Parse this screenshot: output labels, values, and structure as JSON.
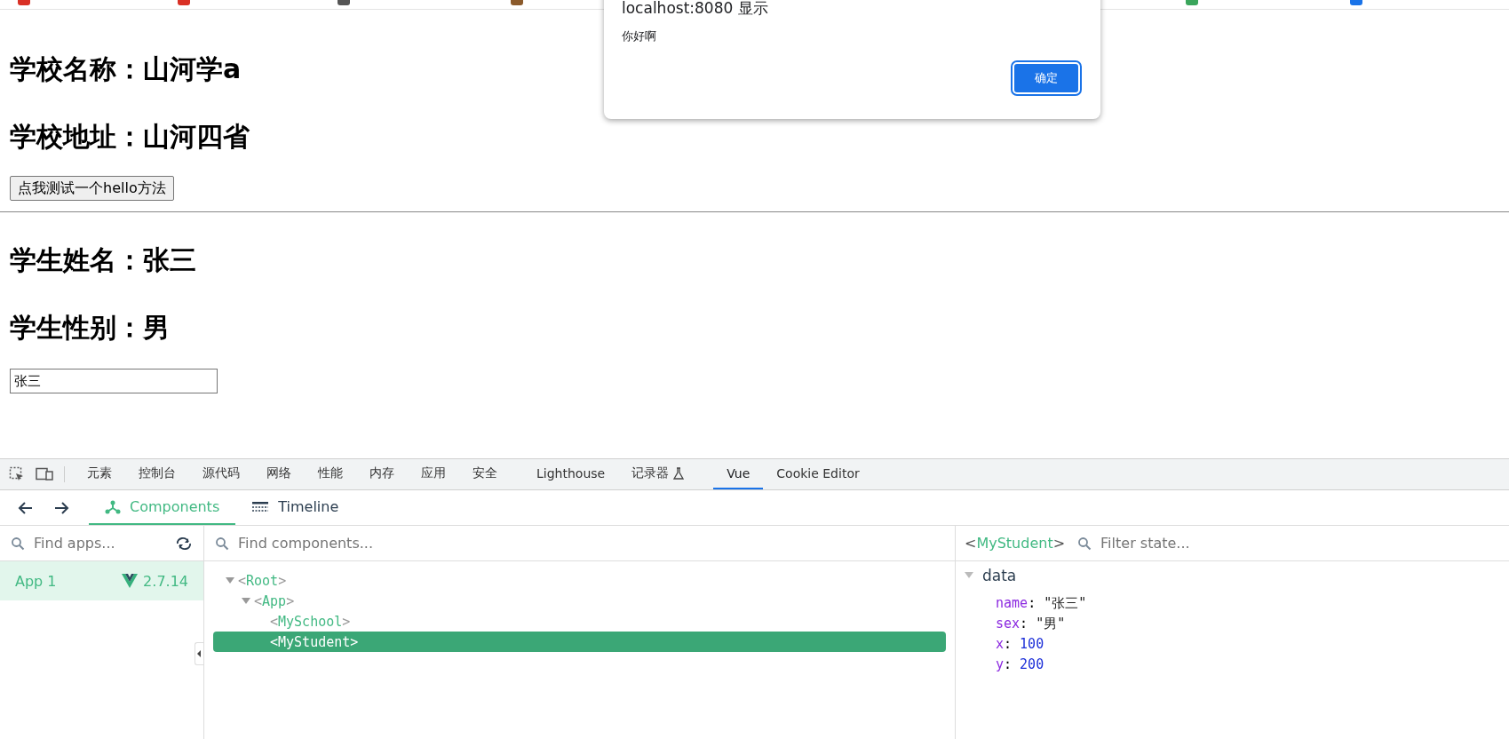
{
  "page": {
    "school_name": "学校名称：山河学a",
    "school_address": "学校地址：山河四省",
    "hello_button": "点我测试一个hello方法",
    "student_name": "学生姓名：张三",
    "student_sex": "学生性别：男",
    "name_input": {
      "value": "张三"
    }
  },
  "alert": {
    "title": "localhost:8080 显示",
    "message": "你好啊",
    "ok_button": "确定"
  },
  "devtools": {
    "tabs": [
      {
        "label": "元素",
        "selected": false,
        "experimental": false
      },
      {
        "label": "控制台",
        "selected": false,
        "experimental": false
      },
      {
        "label": "源代码",
        "selected": false,
        "experimental": false
      },
      {
        "label": "网络",
        "selected": false,
        "experimental": false
      },
      {
        "label": "性能",
        "selected": false,
        "experimental": false
      },
      {
        "label": "内存",
        "selected": false,
        "experimental": false
      },
      {
        "label": "应用",
        "selected": false,
        "experimental": false
      },
      {
        "label": "安全",
        "selected": false,
        "experimental": false
      },
      {
        "label": "Lighthouse",
        "selected": false,
        "experimental": false
      },
      {
        "label": "记录器",
        "selected": false,
        "experimental": true
      },
      {
        "label": "Vue",
        "selected": true,
        "experimental": false
      },
      {
        "label": "Cookie Editor",
        "selected": false,
        "experimental": false
      }
    ],
    "vue_tabs": [
      {
        "label": "Components",
        "selected": true
      },
      {
        "label": "Timeline",
        "selected": false
      }
    ],
    "apps": {
      "search_placeholder": "Find apps...",
      "items": [
        {
          "name": "App 1",
          "version": "2.7.14",
          "selected": true
        }
      ]
    },
    "components": {
      "search_placeholder": "Find components...",
      "tree": [
        {
          "name": "<Root>",
          "expanded": true,
          "selected": false,
          "children": [
            {
              "name": "<App>",
              "expanded": true,
              "selected": false,
              "children": [
                {
                  "name": "<MySchool>",
                  "selected": false
                },
                {
                  "name": "<MyStudent>",
                  "selected": true
                }
              ]
            }
          ]
        }
      ]
    },
    "inspector": {
      "component": "<MyStudent>",
      "filter_placeholder": "Filter state...",
      "section": {
        "label": "data",
        "expanded": true,
        "fields": [
          {
            "key": "name:",
            "value": "\"张三\"",
            "kind": "string"
          },
          {
            "key": "sex:",
            "value": "\"男\"",
            "kind": "string"
          },
          {
            "key": "x:",
            "value": "100",
            "kind": "number"
          },
          {
            "key": "y:",
            "value": "200",
            "kind": "number"
          }
        ]
      }
    }
  }
}
